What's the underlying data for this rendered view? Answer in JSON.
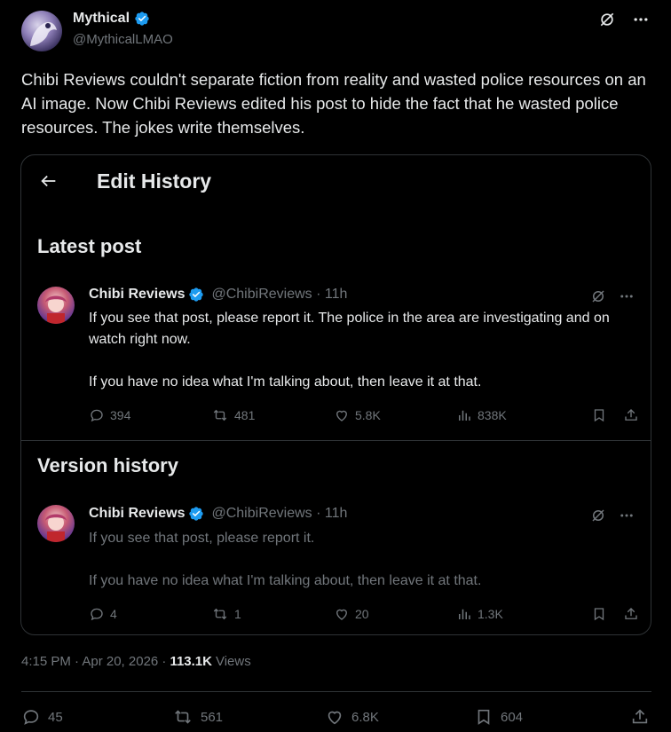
{
  "post": {
    "author_name": "Mythical",
    "author_handle": "@MythicalLMAO",
    "text": "Chibi Reviews couldn't separate fiction from reality and wasted police resources on an AI image. Now Chibi Reviews edited his post to hide the fact that he wasted police resources. The jokes write themselves.",
    "time": "4:15 PM · Apr 20, 2026 ·",
    "views_count": "113.1K",
    "views_label": "Views",
    "replies": "45",
    "reposts": "561",
    "likes": "6.8K",
    "bookmarks": "604"
  },
  "card": {
    "title": "Edit History",
    "latest_title": "Latest post",
    "history_title": "Version history",
    "latest": {
      "name": "Chibi Reviews",
      "handle": "@ChibiReviews · 11h",
      "line1": "If you see that post, please report it. The police in the area are investigating and on watch right now.",
      "line2": "If you have no idea what I'm talking about, then leave it at that.",
      "replies": "394",
      "reposts": "481",
      "likes": "5.8K",
      "views": "838K"
    },
    "previous": {
      "name": "Chibi Reviews",
      "handle": "@ChibiReviews · 11h",
      "line1": "If you see that post, please report it.",
      "line2": "If you have no idea what I'm talking about, then leave it at that.",
      "replies": "4",
      "reposts": "1",
      "likes": "20",
      "views": "1.3K"
    }
  },
  "colors": {
    "verified": "#1d9bf0",
    "muted": "#71767b",
    "text": "#e7e9ea",
    "border": "#2f3336"
  }
}
